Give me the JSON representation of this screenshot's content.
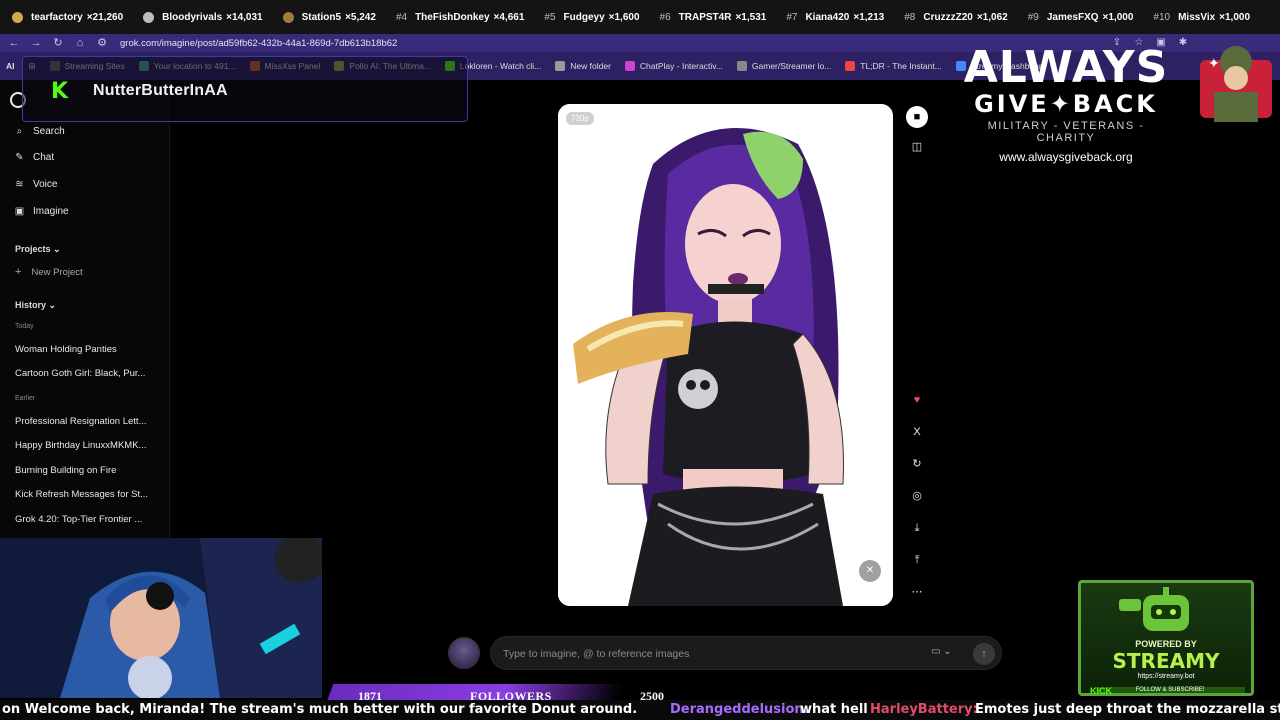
{
  "leaderboard": [
    {
      "rank": "",
      "name": "tearfactory",
      "score": "21,260",
      "medal": "#d4a94a"
    },
    {
      "rank": "",
      "name": "Bloodyrivals",
      "score": "14,031",
      "medal": "#bcbcbc"
    },
    {
      "rank": "",
      "name": "Station5",
      "score": "5,242",
      "medal": "#a07a3c"
    },
    {
      "rank": "#4",
      "name": "TheFishDonkey",
      "score": "4,661",
      "medal": ""
    },
    {
      "rank": "#5",
      "name": "Fudgeyy",
      "score": "1,600",
      "medal": ""
    },
    {
      "rank": "#6",
      "name": "TRAPST4R",
      "score": "1,531",
      "medal": ""
    },
    {
      "rank": "#7",
      "name": "Kiana420",
      "score": "1,213",
      "medal": ""
    },
    {
      "rank": "#8",
      "name": "CruzzzZ20",
      "score": "1,062",
      "medal": ""
    },
    {
      "rank": "#9",
      "name": "JamesFXQ",
      "score": "1,000",
      "medal": ""
    },
    {
      "rank": "#10",
      "name": "MissVix",
      "score": "1,000",
      "medal": ""
    }
  ],
  "browser": {
    "url": "grok.com/imagine/post/ad59fb62-432b-44a1-869d-7db613b18b62",
    "bookmarks": [
      {
        "label": "Streaming Sites",
        "color": "#666"
      },
      {
        "label": "Your location to 491...",
        "color": "#4a9"
      },
      {
        "label": "MissXss Panel",
        "color": "#c63"
      },
      {
        "label": "Pollo AI: The Ultima...",
        "color": "#aa4"
      },
      {
        "label": "Lokloren - Watch cli...",
        "color": "#53fc18"
      },
      {
        "label": "New folder",
        "color": "#999"
      },
      {
        "label": "ChatPlay - Interactiv...",
        "color": "#c4c"
      },
      {
        "label": "Gamer/Streamer lo...",
        "color": "#888"
      },
      {
        "label": "TL;DR - The Instant...",
        "color": "#e44"
      },
      {
        "label": "Streamy Dashboard",
        "color": "#48f"
      }
    ]
  },
  "kick_overlay": {
    "name": "NutterButterInAA"
  },
  "sidebar": {
    "items": [
      {
        "label": "Search",
        "icon": "search-icon"
      },
      {
        "label": "Chat",
        "icon": "chat-icon"
      },
      {
        "label": "Voice",
        "icon": "voice-icon"
      },
      {
        "label": "Imagine",
        "icon": "image-icon"
      }
    ],
    "projects_heading": "Projects",
    "new_project": "New Project",
    "history_heading": "History",
    "today_label": "Today",
    "today_items": [
      "Woman Holding Panties",
      "Cartoon Goth Girl: Black, Pur..."
    ],
    "earlier_label": "Earlier",
    "earlier_items": [
      "Professional Resignation Lett...",
      "Happy Birthday LinuxxMKMK...",
      "Burning Building on Fire",
      "Kick Refresh Messages for St...",
      "Grok 4.20: Top-Tier Frontier ..."
    ]
  },
  "image_card": {
    "resolution_badge": "720p"
  },
  "prompt": {
    "placeholder": "Type to imagine, @ to reference images"
  },
  "agb": {
    "title": "ALWAYS",
    "subtitle": "GIVE✦BACK",
    "tagline": "MILITARY - VETERANS - CHARITY",
    "url": "www.alwaysgiveback.org"
  },
  "streamy": {
    "powered_by": "POWERED BY",
    "title": "STREAMY",
    "url": "https://streamy.bot",
    "follow": "FOLLOW & SUBSCRIBE!",
    "kick": "KICK"
  },
  "followers": {
    "current": "1871",
    "label": "FOLLOWERS",
    "goal": "2500"
  },
  "ticker": {
    "text1": "on Welcome back, Miranda! The stream's much better with our favorite Donut around.",
    "user1": "Derangeddelusion:",
    "msg1": "what hell",
    "user2": "HarleyBattery:",
    "msg2": "Emotes just deep throat the mozzarella stick"
  }
}
